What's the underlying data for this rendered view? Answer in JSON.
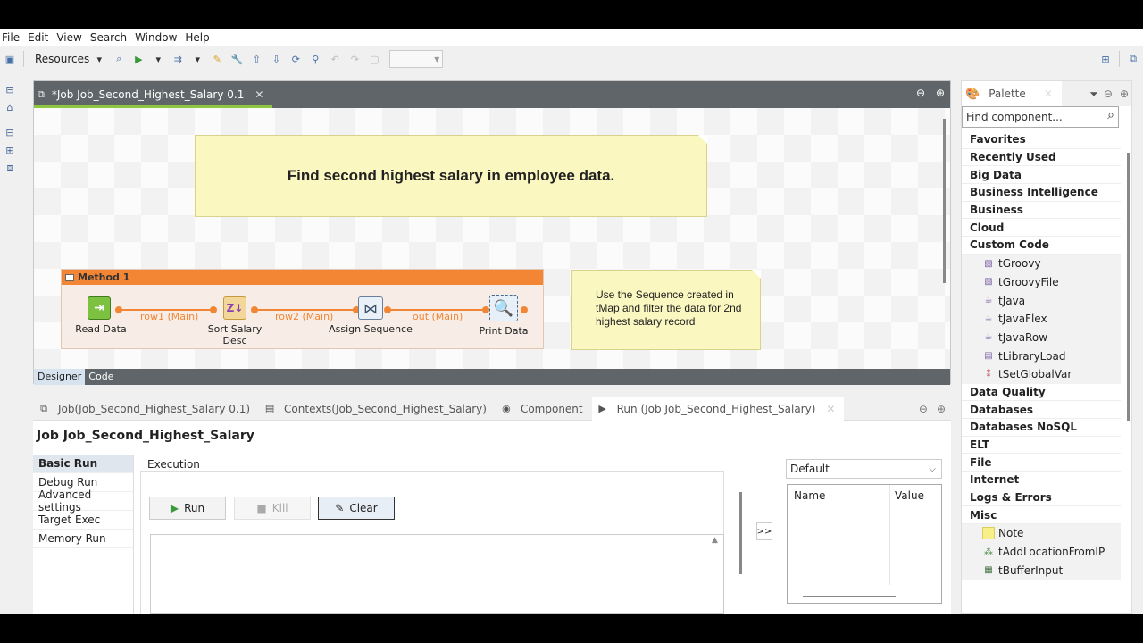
{
  "menu": [
    "File",
    "Edit",
    "View",
    "Search",
    "Window",
    "Help"
  ],
  "toolbar": {
    "perspective_label": "Resources"
  },
  "editor": {
    "tab_title": "*Job Job_Second_Highest_Salary 0.1",
    "bottom_tabs": [
      "Designer",
      "Code"
    ],
    "note_title": "Find second highest salary in employee data.",
    "note_side": "Use the Sequence created in tMap and filter the data for 2nd highest salary record",
    "subjob_title": "Method 1",
    "components": [
      {
        "label": "Read Data"
      },
      {
        "label": "Sort Salary Desc"
      },
      {
        "label": "Assign Sequence"
      },
      {
        "label": "Print Data"
      }
    ],
    "links": [
      "row1 (Main)",
      "row2 (Main)",
      "out (Main)"
    ]
  },
  "bottom": {
    "tabs": [
      {
        "label": "Job(Job_Second_Highest_Salary 0.1)",
        "icon": "job-icon"
      },
      {
        "label": "Contexts(Job_Second_Highest_Salary)",
        "icon": "contexts-icon"
      },
      {
        "label": "Component",
        "icon": "component-icon"
      },
      {
        "label": "Run (Job Job_Second_Highest_Salary)",
        "icon": "run-icon"
      }
    ],
    "job_title": "Job Job_Second_Highest_Salary",
    "run_sidebar": [
      "Basic Run",
      "Debug Run",
      "Advanced settings",
      "Target Exec",
      "Memory Run"
    ],
    "execution_label": "Execution",
    "buttons": {
      "run": "Run",
      "kill": "Kill",
      "clear": "Clear"
    },
    "context_select": "Default",
    "expand_label": ">>",
    "ctx_columns": [
      "Name",
      "Value"
    ]
  },
  "palette": {
    "tab": "Palette",
    "search_placeholder": "Find component...",
    "categories_top": [
      "Favorites",
      "Recently Used",
      "Big Data",
      "Business Intelligence",
      "Business",
      "Cloud",
      "Custom Code"
    ],
    "custom_code_items": [
      "tGroovy",
      "tGroovyFile",
      "tJava",
      "tJavaFlex",
      "tJavaRow",
      "tLibraryLoad",
      "tSetGlobalVar"
    ],
    "categories_mid": [
      "Data Quality",
      "Databases",
      "Databases NoSQL",
      "ELT",
      "File",
      "Internet",
      "Logs & Errors",
      "Misc"
    ],
    "misc_items": [
      "Note",
      "tAddLocationFromIP",
      "tBufferInput"
    ]
  }
}
